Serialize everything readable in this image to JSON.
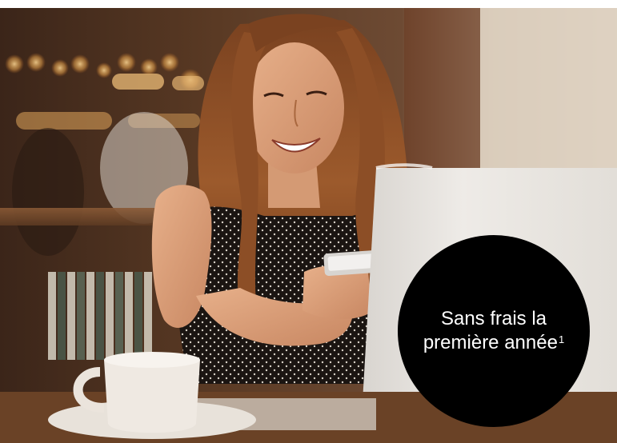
{
  "photo": {
    "subject": "smiling-woman-using-smartphone-in-cafe-photo"
  },
  "badge": {
    "line1": "Sans frais la",
    "line2": "première année",
    "footnote": "1",
    "background": "#000000",
    "text_color": "#ffffff"
  }
}
